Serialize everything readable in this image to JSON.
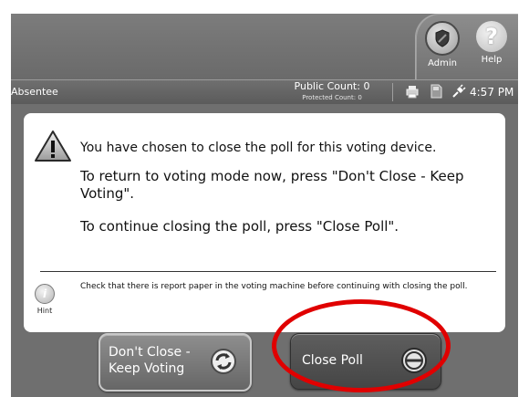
{
  "topbar": {
    "admin_label": "Admin",
    "help_label": "Help",
    "help_glyph": "?"
  },
  "status": {
    "mode": "Absentee",
    "public_count": "Public Count: 0",
    "protected_count": "Protected Count: 0",
    "time": "4:57 PM",
    "icons": [
      "printer-icon",
      "memory-card-icon",
      "power-plug-icon"
    ]
  },
  "dialog": {
    "message_1": "You have chosen to close the poll for this voting device.",
    "message_2": "To return to voting mode now, press \"Don't Close - Keep Voting\".",
    "message_3": "To continue closing the poll, press \"Close Poll\".",
    "hint_label": "Hint",
    "hint_text": "Check that there is report paper in the voting machine before continuing with closing the poll."
  },
  "buttons": {
    "dont_close_line1": "Don't Close -",
    "dont_close_line2": "Keep Voting",
    "close_poll": "Close Poll"
  },
  "colors": {
    "highlight": "#e00000",
    "screen_bg": "#6f6f6f",
    "dialog_bg": "#ffffff"
  }
}
